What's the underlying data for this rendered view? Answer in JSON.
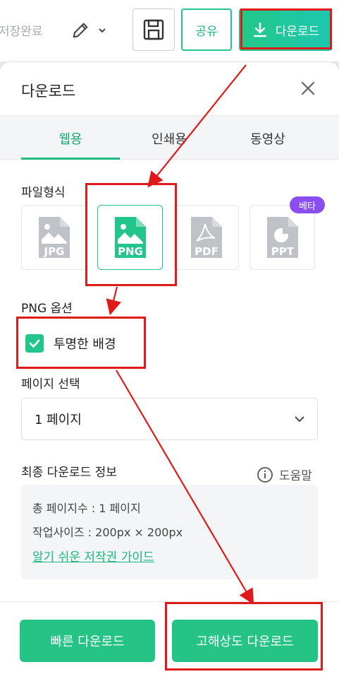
{
  "toolbar": {
    "save_status": "저장완료",
    "share_label": "공유",
    "download_label": "다운로드"
  },
  "panel": {
    "title": "다운로드",
    "tabs": [
      {
        "label": "웹용",
        "active": true
      },
      {
        "label": "인쇄용",
        "active": false
      },
      {
        "label": "동영상",
        "active": false
      }
    ],
    "file_format_label": "파일형식",
    "formats": [
      {
        "label": "JPG",
        "selected": false
      },
      {
        "label": "PNG",
        "selected": true
      },
      {
        "label": "PDF",
        "selected": false
      },
      {
        "label": "PPT",
        "selected": false
      }
    ],
    "beta_badge": "베타",
    "png_options_label": "PNG 옵션",
    "transparent_bg_label": "투명한 배경",
    "transparent_bg_checked": true,
    "page_select_label": "페이지 선택",
    "page_select_value": "1 페이지",
    "final_info_label": "최종 다운로드 정보",
    "help_label": "도움말",
    "info": {
      "total_pages": "총 페이지수 : 1 페이지",
      "work_size": "작업사이즈 : 200px × 200px",
      "guide_link": "알기 쉬운 저작권 가이드"
    },
    "quick_download_label": "빠른 다운로드",
    "hires_download_label": "고해상도 다운로드"
  },
  "colors": {
    "accent": "#22c58b",
    "accent_text": "#16a56f",
    "beta": "#8a4ef0",
    "annotation": "#e01919"
  }
}
